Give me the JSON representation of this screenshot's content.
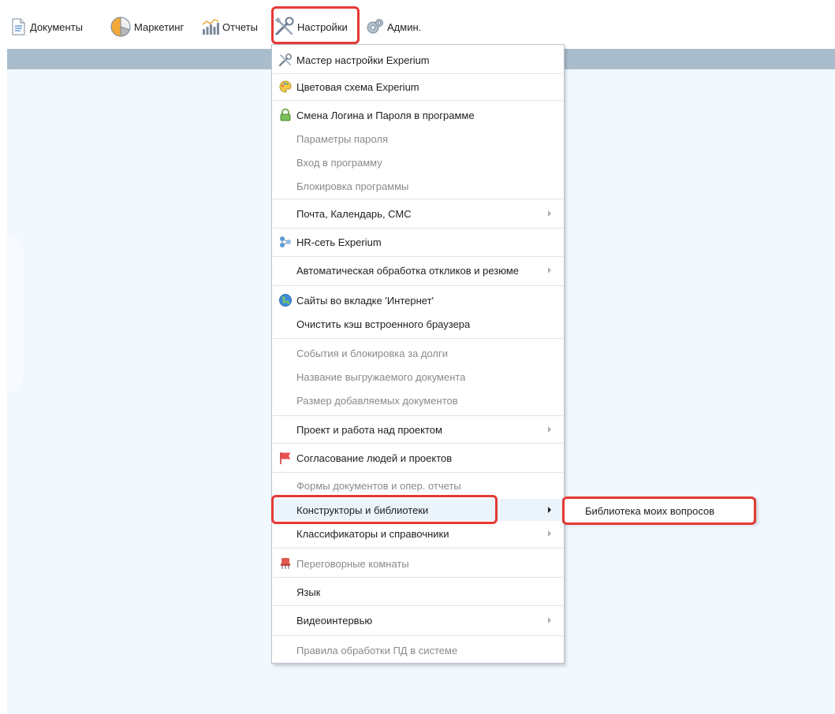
{
  "toolbar": {
    "documents": "Документы",
    "marketing": "Маркетинг",
    "reports": "Отчеты",
    "settings": "Настройки",
    "admin": "Админ."
  },
  "menu": {
    "items": [
      {
        "label": "Мастер настройки Experium",
        "icon": "tools-icon"
      },
      {
        "label": "Цветовая схема Experium",
        "icon": "palette-icon"
      },
      {
        "label": "Смена Логина и Пароля в программе",
        "icon": "lock-icon"
      },
      {
        "label": "Параметры пароля",
        "disabled": true
      },
      {
        "label": "Вход в программу",
        "disabled": true
      },
      {
        "label": "Блокировка программы",
        "disabled": true
      },
      {
        "label": "Почта, Календарь, СМС",
        "submenu": true
      },
      {
        "label": "HR-сеть Experium",
        "icon": "network-icon"
      },
      {
        "label": "Автоматическая обработка откликов и резюме",
        "submenu": true
      },
      {
        "label": "Сайты во вкладке 'Интернет'",
        "icon": "globe-icon"
      },
      {
        "label": "Очистить кэш встроенного браузера"
      },
      {
        "label": "События и блокировка за долги",
        "disabled": true
      },
      {
        "label": "Название выгружаемого документа",
        "disabled": true
      },
      {
        "label": "Размер добавляемых документов",
        "disabled": true
      },
      {
        "label": "Проект и работа над проектом",
        "submenu": true
      },
      {
        "label": "Согласование людей и проектов",
        "icon": "flag-icon"
      },
      {
        "label": "Формы документов и опер. отчеты",
        "disabled": true
      },
      {
        "label": "Конструкторы и библиотеки",
        "submenu": true,
        "active": true
      },
      {
        "label": "Классификаторы и справочники",
        "submenu": true
      },
      {
        "label": "Переговорные комнаты",
        "icon": "chair-icon",
        "disabled": true
      },
      {
        "label": "Язык"
      },
      {
        "label": "Видеоинтервью",
        "submenu": true
      },
      {
        "label": "Правила обработки ПД в системе",
        "disabled": true
      }
    ]
  },
  "submenu": {
    "item": "Библиотека моих вопросов"
  },
  "colors": {
    "highlight": "#e53935",
    "band": "#aabdcd",
    "content_bg": "#f1f8fe",
    "hover_bg": "#ebf3fb",
    "disabled_text": "#8a8a8a"
  }
}
